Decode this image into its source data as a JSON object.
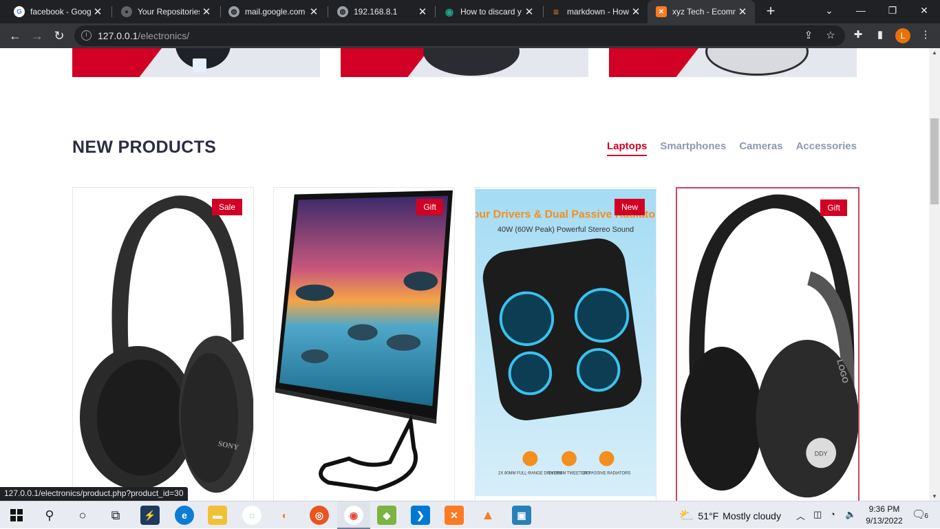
{
  "browser": {
    "tabs": [
      {
        "title": "facebook - Goog",
        "icon": "google-icon",
        "color": "#ffffff"
      },
      {
        "title": "Your Repositories",
        "icon": "github-icon",
        "color": "#5f6368"
      },
      {
        "title": "mail.google.com",
        "icon": "globe-icon",
        "color": "#9aa0a6"
      },
      {
        "title": "192.168.8.1",
        "icon": "globe-icon",
        "color": "#9aa0a6"
      },
      {
        "title": "How to discard y",
        "icon": "eye-icon",
        "color": "#1fa389"
      },
      {
        "title": "markdown - How",
        "icon": "stackoverflow-icon",
        "color": "#f48024"
      },
      {
        "title": "xyz Tech - Ecomm",
        "icon": "xampp-icon",
        "color": "#fb7a24"
      }
    ],
    "url_host": "127.0.0.1",
    "url_path": "/electronics/",
    "profile_initial": "L"
  },
  "page": {
    "section_title": "NEW PRODUCTS",
    "categories": [
      {
        "label": "Laptops",
        "active": true
      },
      {
        "label": "Smartphones",
        "active": false
      },
      {
        "label": "Cameras",
        "active": false
      },
      {
        "label": "Accessories",
        "active": false
      }
    ],
    "products": [
      {
        "badge": "Sale",
        "image": "headphones-sony"
      },
      {
        "badge": "Gift",
        "image": "all-in-one-desktop"
      },
      {
        "badge": "New",
        "image": "bluetooth-speaker"
      },
      {
        "badge": "Gift",
        "image": "headphones-black"
      }
    ],
    "speaker_headline": "Four Drivers & Dual Passive Radiators",
    "speaker_subline": "40W (60W Peak) Powerful Stereo Sound",
    "speaker_features": [
      "2X 80MM FULL-RANGE DRIVERS",
      "2X 20MM TWEETERS",
      "2X PASSIVE RADIATORS"
    ],
    "brand_sony": "SONY",
    "brand_logo": "LOGO",
    "brand_ddy": "DDY",
    "status_url": "127.0.0.1/electronics/product.php?product_id=30",
    "accent": "#d10024"
  },
  "taskbar": {
    "temperature": "51°F",
    "weather": "Mostly cloudy",
    "time": "9:36 PM",
    "date": "9/13/2022",
    "notifications": "6"
  }
}
